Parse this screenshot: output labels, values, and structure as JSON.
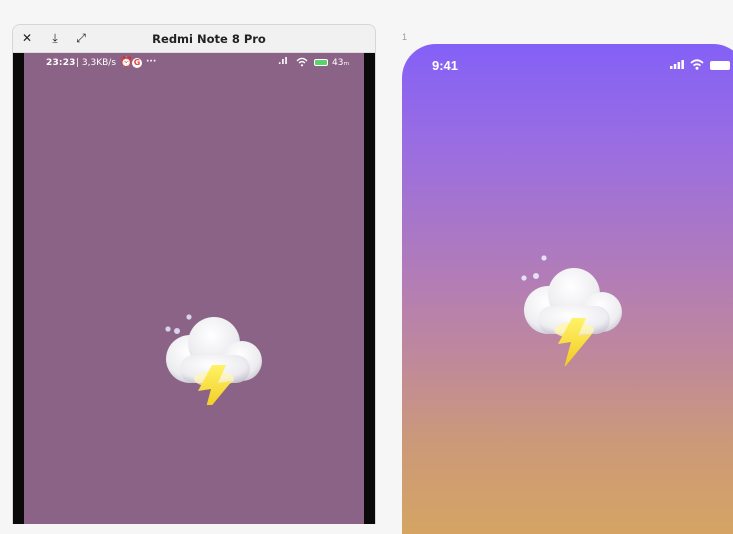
{
  "emulator": {
    "device_name": "Redmi Note 8 Pro",
    "toolbar_icons": [
      "close-icon",
      "download-icon",
      "expand-icon"
    ],
    "status_bar": {
      "time": "23:23",
      "network_speed": "| 3,3KB/s",
      "alarm_icon": "alarm-icon",
      "google_letter": "G",
      "more": "···",
      "signal_icon": "signal-icon",
      "wifi_icon": "wifi-icon",
      "battery_icon": "battery-charging-icon",
      "battery_percent": "43ₘ"
    },
    "screen_background": "#8b6386",
    "weather_icon": "storm-cloud-moon-icon"
  },
  "artboard": {
    "index_label": "1",
    "status_bar": {
      "time": "9:41",
      "signal_icon": "cellular-icon",
      "wifi_icon": "wifi-icon",
      "battery_icon": "battery-icon"
    },
    "gradient": [
      "#8460f7",
      "#b07bbb",
      "#d5a463"
    ],
    "weather_icon": "storm-cloud-moon-icon"
  },
  "colors": {
    "cloud": "#f3f3f5",
    "moon": "#6a55e6",
    "bolt": "#f6e032"
  }
}
